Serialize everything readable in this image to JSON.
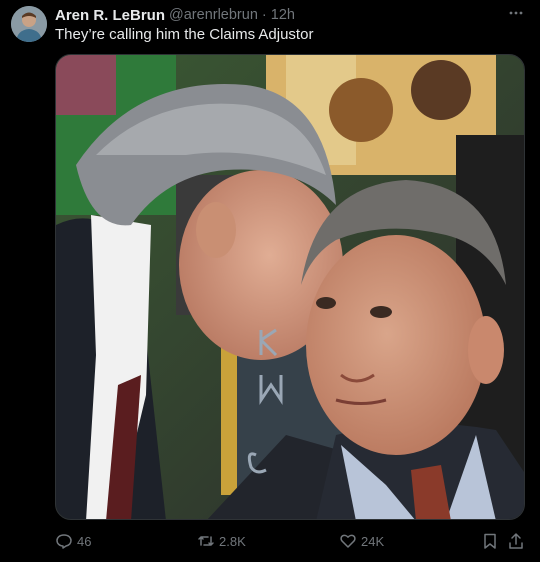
{
  "tweet": {
    "author_name": "Aren R. LeBrun",
    "author_handle": "@arenrlebrun",
    "separator": "·",
    "time": "12h",
    "text": "They’re calling him the Claims Adjustor"
  },
  "actions": {
    "replies": "46",
    "retweets": "2.8K",
    "likes": "24K"
  },
  "icons": {
    "more": "more-options-icon",
    "reply": "reply-icon",
    "retweet": "retweet-icon",
    "like": "heart-icon",
    "bookmark": "bookmark-icon",
    "share": "share-icon"
  },
  "colors": {
    "background": "#000000",
    "text": "#e7e9ea",
    "muted": "#71767b"
  }
}
